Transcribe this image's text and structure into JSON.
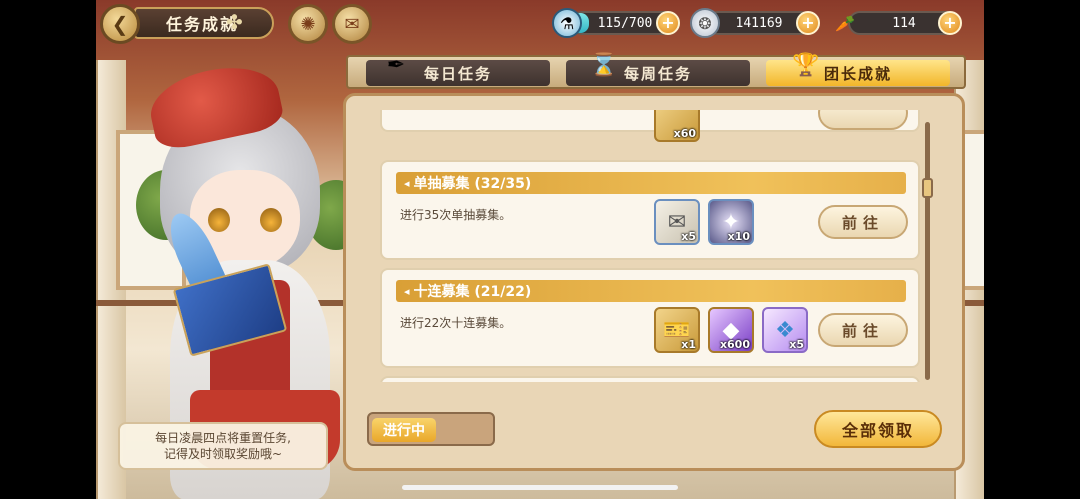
{
  "header": {
    "title": "任务成就",
    "resources": [
      {
        "icon": "stamina-icon",
        "value": "115/700",
        "fill": 0.164
      },
      {
        "icon": "gem-icon",
        "value": "141169"
      },
      {
        "icon": "carrot-icon",
        "value": "114"
      }
    ]
  },
  "tabs": [
    {
      "label": "每日任务",
      "active": false
    },
    {
      "label": "每周任务",
      "active": false
    },
    {
      "label": "团长成就",
      "active": true
    }
  ],
  "partial_top_reward_qty": "x60",
  "achievements": [
    {
      "title": "单抽募集 (32/35)",
      "description": "进行35次单抽募集。",
      "rewards": [
        {
          "icon": "ticket-scroll-icon",
          "qty": "x5"
        },
        {
          "icon": "crystal-orb-icon",
          "qty": "x10"
        }
      ],
      "action": "前往"
    },
    {
      "title": "十连募集 (21/22)",
      "description": "进行22次十连募集。",
      "rewards": [
        {
          "icon": "golden-ticket-icon",
          "qty": "x1"
        },
        {
          "icon": "purple-crystal-icon",
          "qty": "x600"
        },
        {
          "icon": "rainbow-crystal-icon",
          "qty": "x5"
        }
      ],
      "action": "前往"
    }
  ],
  "footer": {
    "status_label": "进行中",
    "claim_all_label": "全部领取"
  },
  "tip": {
    "line1": "每日凌晨四点将重置任务,",
    "line2": "记得及时领取奖励哦~"
  },
  "colors": {
    "accent": "#f2b62a",
    "header_bar": "#d99f36",
    "panel_bg": "#e9d6b6"
  }
}
